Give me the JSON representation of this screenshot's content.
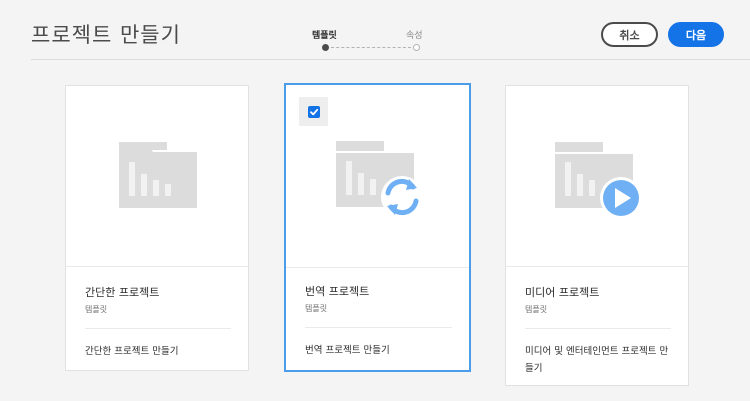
{
  "header": {
    "title": "프로젝트 만들기",
    "steps": [
      {
        "label": "템플릿",
        "active": true
      },
      {
        "label": "속성",
        "active": false
      }
    ],
    "cancel_label": "취소",
    "next_label": "다음"
  },
  "colors": {
    "accent": "#1473e6",
    "selected_border": "#4b9ce9",
    "icon_gray": "#d9d9d9",
    "icon_blue": "#6fb0f5"
  },
  "cards": [
    {
      "title": "간단한 프로젝트",
      "subtitle": "템플릿",
      "description": "간단한 프로젝트 만들기",
      "icon": "folder-chart-icon",
      "selected": false
    },
    {
      "title": "번역 프로젝트",
      "subtitle": "템플릿",
      "description": "번역 프로젝트 만들기",
      "icon": "folder-sync-icon",
      "selected": true
    },
    {
      "title": "미디어 프로젝트",
      "subtitle": "템플릿",
      "description": "미디어 및 엔터테인먼트 프로젝트 만들기",
      "icon": "folder-play-icon",
      "selected": false
    }
  ]
}
